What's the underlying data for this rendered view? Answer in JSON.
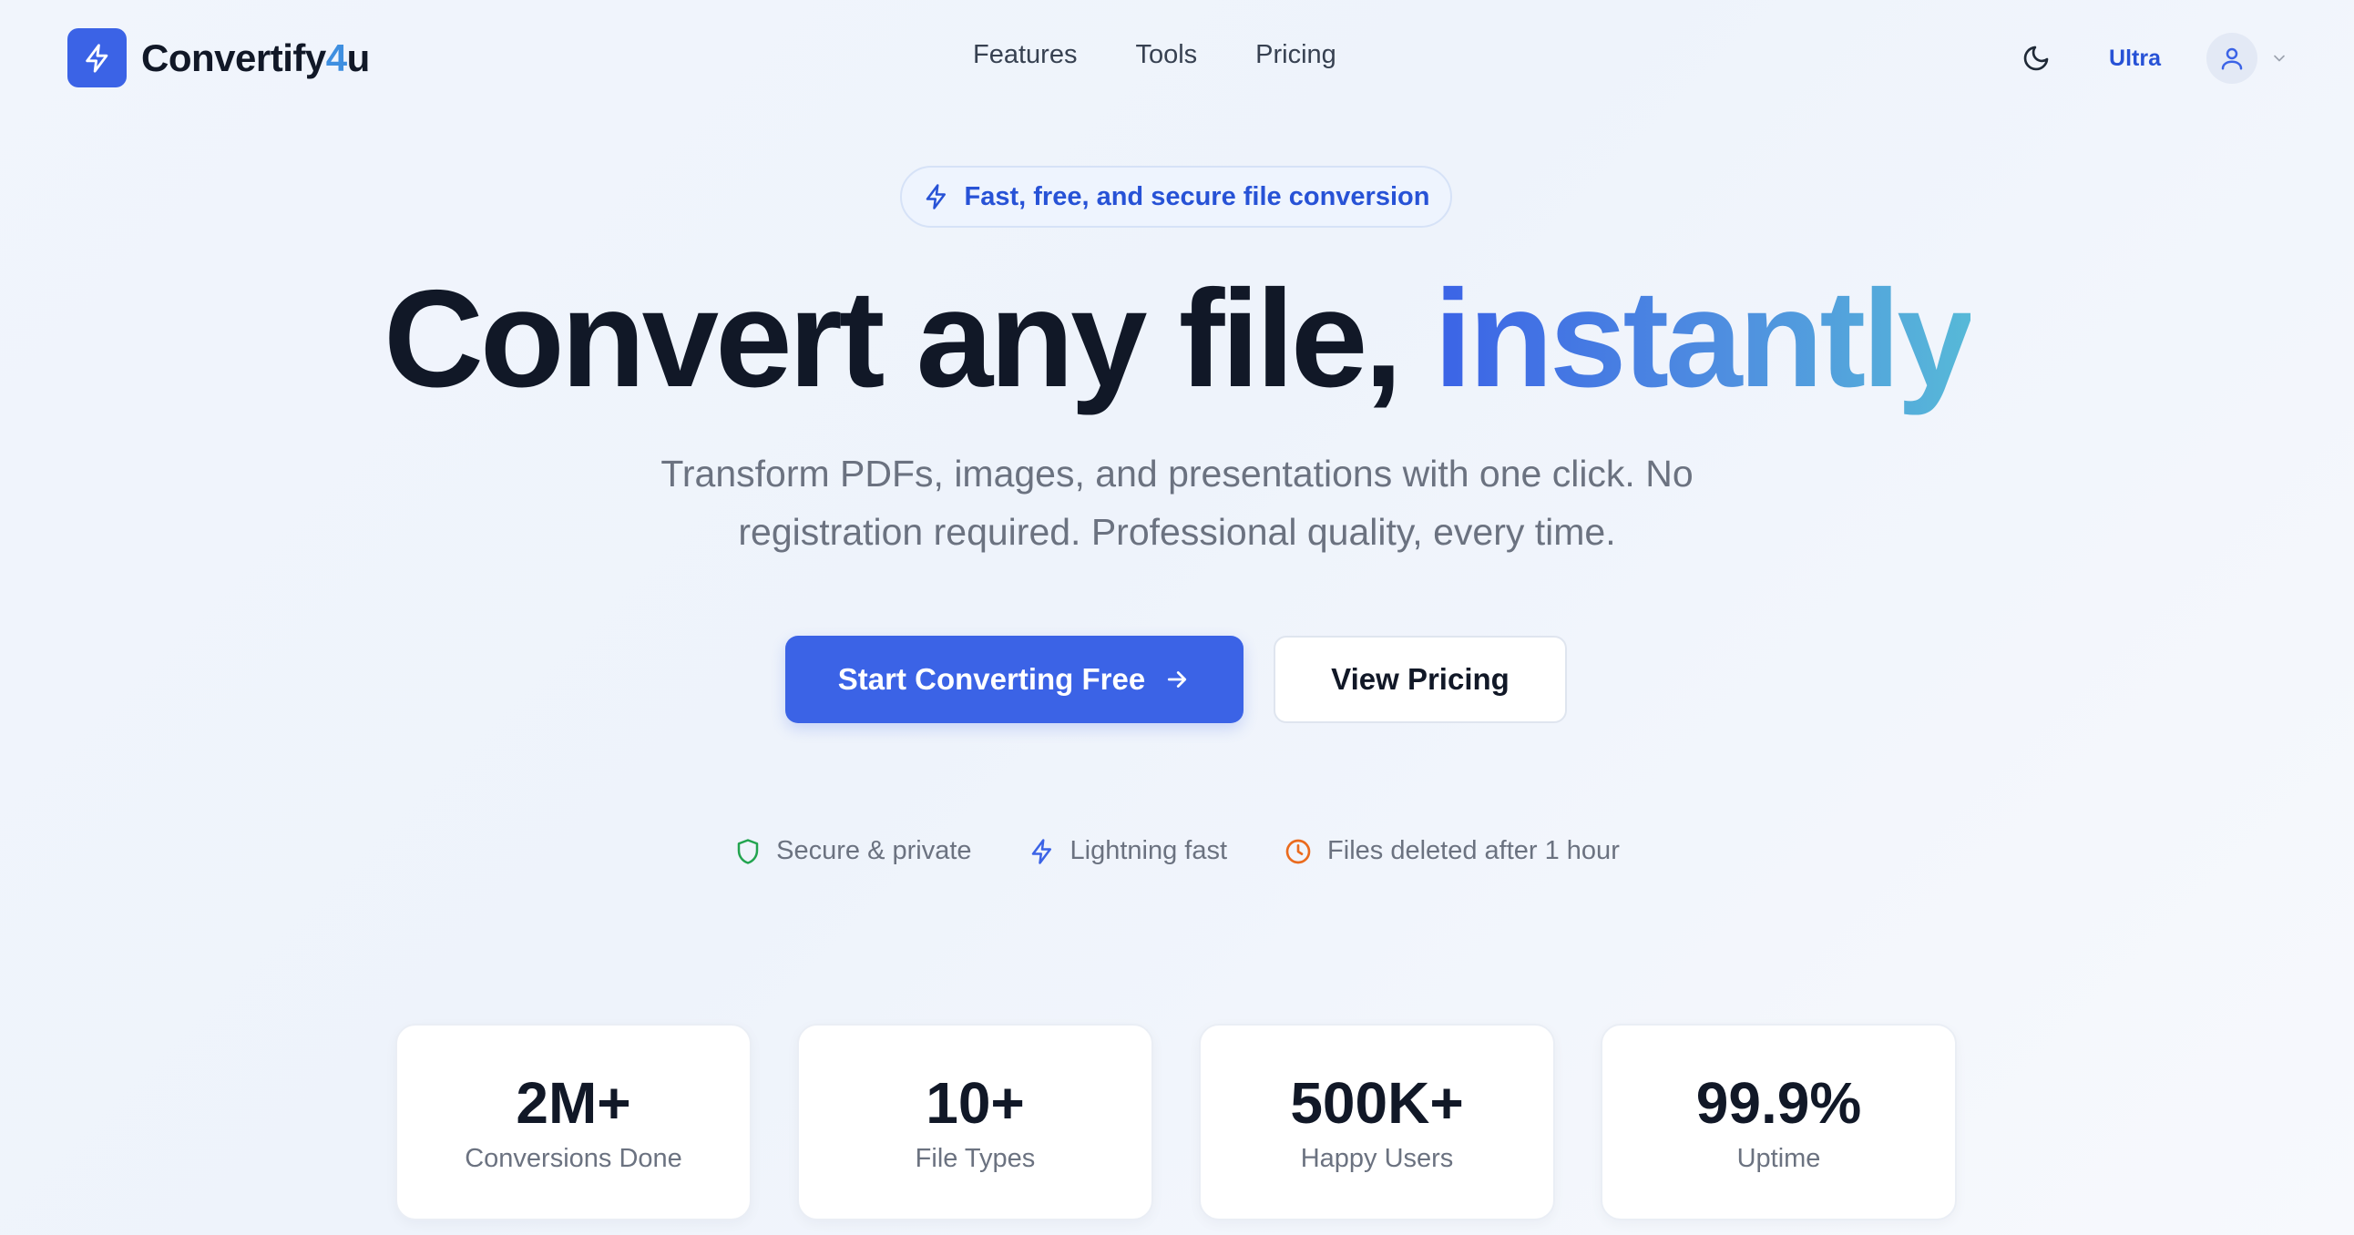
{
  "brand": {
    "name_prefix": "Convertify",
    "name_digit": "4",
    "name_suffix": "u"
  },
  "nav": {
    "items": [
      "Features",
      "Tools",
      "Pricing"
    ]
  },
  "header": {
    "plan_badge": "Ultra"
  },
  "hero": {
    "pill": "Fast, free, and secure file conversion",
    "headline_main": "Convert any file,",
    "headline_accent": "instantly",
    "subhead": "Transform PDFs, images, and presentations with one click. No registration required. Professional quality, every time.",
    "primary_cta": "Start Converting Free",
    "secondary_cta": "View Pricing"
  },
  "features": [
    {
      "label": "Secure & private",
      "icon": "shield-icon",
      "color": "#22a44f"
    },
    {
      "label": "Lightning fast",
      "icon": "lightning-icon",
      "color": "#3b63e6"
    },
    {
      "label": "Files deleted after 1 hour",
      "icon": "clock-icon",
      "color": "#ea6b1e"
    }
  ],
  "stats": [
    {
      "value": "2M+",
      "label": "Conversions Done"
    },
    {
      "value": "10+",
      "label": "File Types"
    },
    {
      "value": "500K+",
      "label": "Happy Users"
    },
    {
      "value": "99.9%",
      "label": "Uptime"
    }
  ],
  "colors": {
    "accent": "#3b63e6",
    "accent_light": "#57b9d8",
    "text_dark": "#111827",
    "text_muted": "#6b7280"
  }
}
